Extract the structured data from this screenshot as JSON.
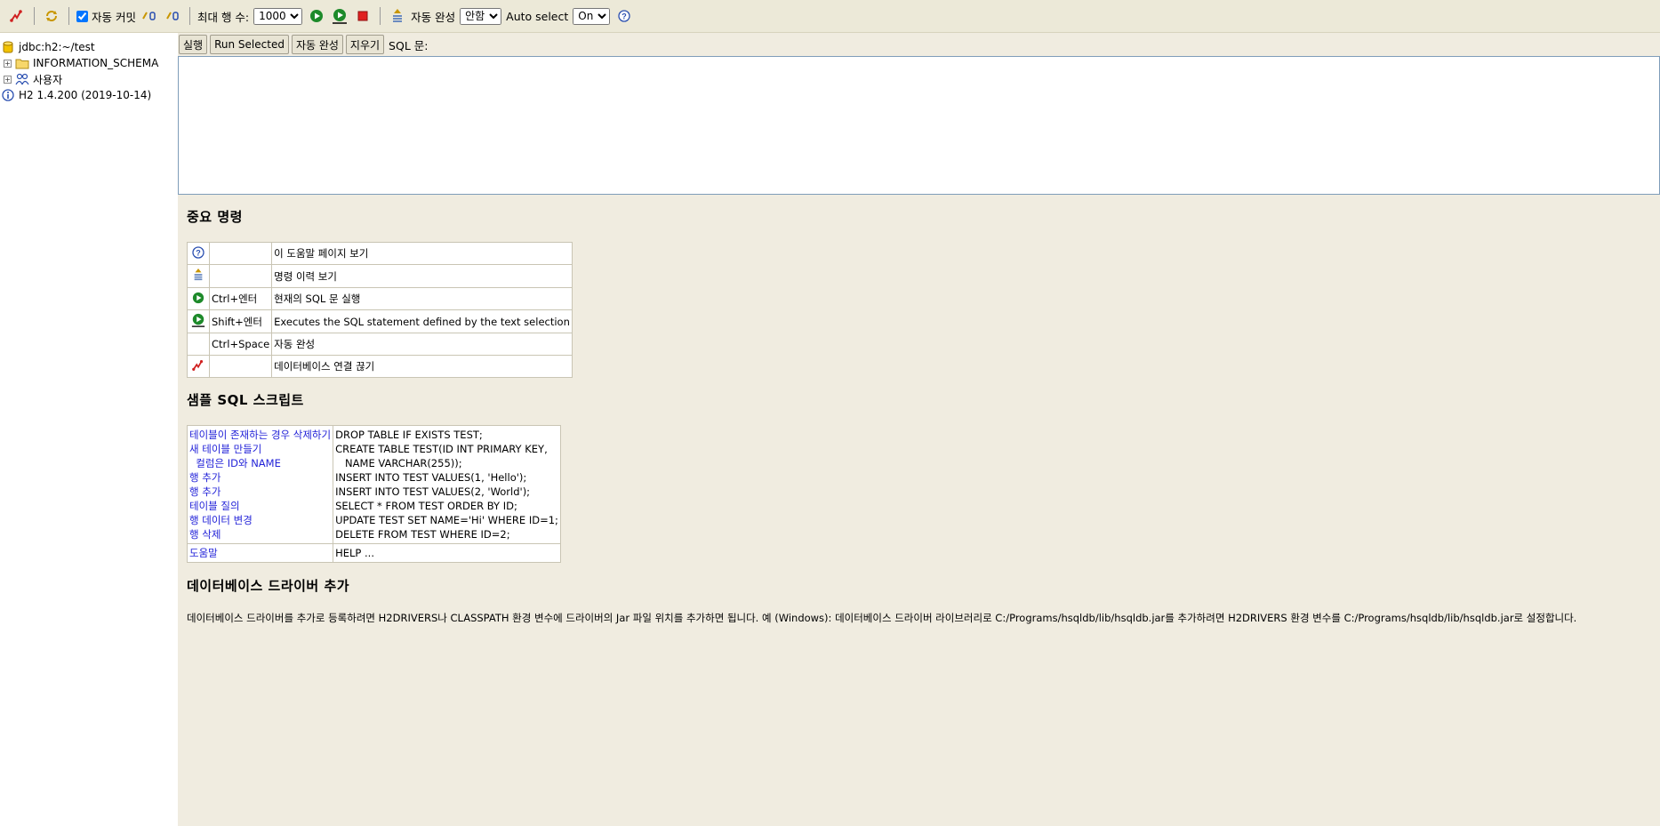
{
  "toolbar": {
    "autocommit_label": "자동 커밋",
    "autocommit_checked": true,
    "max_rows_label": "최대 행 수:",
    "max_rows_value": "1000",
    "autocomplete_label": "자동 완성",
    "autocomplete_value": "안함",
    "autoselect_label": "Auto select",
    "autoselect_value": "On"
  },
  "tree": {
    "connection": "jdbc:h2:~/test",
    "items": [
      {
        "label": "INFORMATION_SCHEMA",
        "icon": "folder-icon"
      },
      {
        "label": "사용자",
        "icon": "users-icon"
      }
    ],
    "version": "H2 1.4.200 (2019-10-14)"
  },
  "query": {
    "run_label": "실행",
    "run_selected_label": "Run Selected",
    "autocomplete_label": "자동 완성",
    "clear_label": "지우기",
    "sql_label": "SQL 문:",
    "sql_value": ""
  },
  "help": {
    "important_title": "중요 명령",
    "commands": [
      {
        "icon": "help-icon",
        "key": "",
        "desc": "이 도움말 페이지 보기"
      },
      {
        "icon": "history-icon",
        "key": "",
        "desc": "명령 이력 보기"
      },
      {
        "icon": "run-icon",
        "key": "Ctrl+엔터",
        "desc": "현재의 SQL 문 실행"
      },
      {
        "icon": "run-selected-icon",
        "key": "Shift+엔터",
        "desc": "Executes the SQL statement defined by the text selection"
      },
      {
        "icon": "",
        "key": "Ctrl+Space",
        "desc": "자동 완성"
      },
      {
        "icon": "disconnect-icon",
        "key": "",
        "desc": "데이터베이스 연결 끊기"
      }
    ],
    "sample_title": "샘플 SQL 스크립트",
    "samples": [
      {
        "label": "테이블이 존재하는 경우 삭제하기",
        "sql": "DROP TABLE IF EXISTS TEST;"
      },
      {
        "label": "새 테이블 만들기",
        "sql": "CREATE TABLE TEST(ID INT PRIMARY KEY,"
      },
      {
        "label": "  컬럼은 ID와 NAME",
        "sql": "   NAME VARCHAR(255));"
      },
      {
        "label": "행 추가",
        "sql": "INSERT INTO TEST VALUES(1, 'Hello');"
      },
      {
        "label": "행 추가",
        "sql": "INSERT INTO TEST VALUES(2, 'World');"
      },
      {
        "label": "테이블 질의",
        "sql": "SELECT * FROM TEST ORDER BY ID;"
      },
      {
        "label": "행 데이터 변경",
        "sql": "UPDATE TEST SET NAME='Hi' WHERE ID=1;"
      },
      {
        "label": "행 삭제",
        "sql": "DELETE FROM TEST WHERE ID=2;"
      }
    ],
    "help_row": {
      "label": "도움말",
      "sql": "HELP ..."
    },
    "driver_title": "데이터베이스 드라이버 추가",
    "driver_text": "데이터베이스 드라이버를 추가로 등록하려면 H2DRIVERS나 CLASSPATH 환경 변수에 드라이버의 Jar 파일 위치를 추가하면 됩니다. 예 (Windows): 데이터베이스 드라이버 라이브러리로 C:/Programs/hsqldb/lib/hsqldb.jar를 추가하려면 H2DRIVERS 환경 변수를 C:/Programs/hsqldb/lib/hsqldb.jar로 설정합니다."
  }
}
